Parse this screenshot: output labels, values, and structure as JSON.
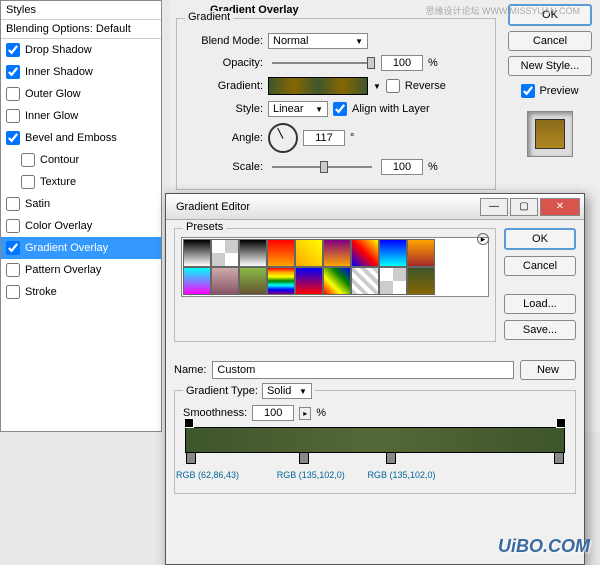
{
  "styles_panel": {
    "header": "Styles",
    "blending": "Blending Options: Default",
    "items": [
      {
        "label": "Drop Shadow",
        "checked": true,
        "indent": false
      },
      {
        "label": "Inner Shadow",
        "checked": true,
        "indent": false
      },
      {
        "label": "Outer Glow",
        "checked": false,
        "indent": false
      },
      {
        "label": "Inner Glow",
        "checked": false,
        "indent": false
      },
      {
        "label": "Bevel and Emboss",
        "checked": true,
        "indent": false
      },
      {
        "label": "Contour",
        "checked": false,
        "indent": true
      },
      {
        "label": "Texture",
        "checked": false,
        "indent": true
      },
      {
        "label": "Satin",
        "checked": false,
        "indent": false
      },
      {
        "label": "Color Overlay",
        "checked": false,
        "indent": false
      },
      {
        "label": "Gradient Overlay",
        "checked": true,
        "indent": false,
        "selected": true
      },
      {
        "label": "Pattern Overlay",
        "checked": false,
        "indent": false
      },
      {
        "label": "Stroke",
        "checked": false,
        "indent": false
      }
    ]
  },
  "gradient_overlay": {
    "section_title": "Gradient Overlay",
    "subsection": "Gradient",
    "blend_mode_label": "Blend Mode:",
    "blend_mode": "Normal",
    "opacity_label": "Opacity:",
    "opacity": "100",
    "opacity_unit": "%",
    "gradient_label": "Gradient:",
    "reverse_label": "Reverse",
    "reverse": false,
    "style_label": "Style:",
    "style": "Linear",
    "align_label": "Align with Layer",
    "align": true,
    "angle_label": "Angle:",
    "angle": "117",
    "angle_unit": "",
    "scale_label": "Scale:",
    "scale": "100",
    "scale_unit": "%"
  },
  "buttons": {
    "ok": "OK",
    "cancel": "Cancel",
    "new_style": "New Style...",
    "preview": "Preview"
  },
  "editor": {
    "title": "Gradient Editor",
    "presets_label": "Presets",
    "ok": "OK",
    "cancel": "Cancel",
    "load": "Load...",
    "save": "Save...",
    "name_label": "Name:",
    "name": "Custom",
    "new": "New",
    "gradient_type_label": "Gradient Type:",
    "gradient_type": "Solid",
    "smoothness_label": "Smoothness:",
    "smoothness": "100",
    "smoothness_unit": "%",
    "stops": [
      {
        "label": "RGB (62,86,43)",
        "pos": 0
      },
      {
        "label": "RGB (135,102,0)",
        "pos": 32
      },
      {
        "label": "RGB (135,102,0)",
        "pos": 55
      }
    ]
  },
  "watermark": "UiBO.COM",
  "watermark2": "思缘设计论坛 WWW.MISSYUAN.COM"
}
